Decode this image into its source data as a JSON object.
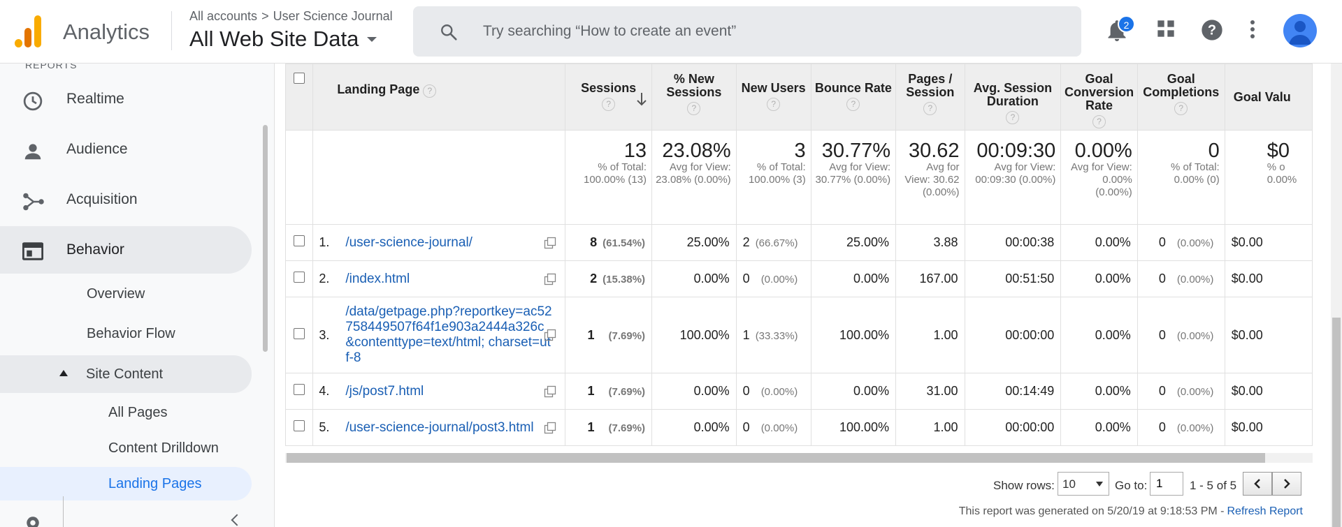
{
  "header": {
    "app_name": "Analytics",
    "breadcrumb_root": "All accounts",
    "breadcrumb_sep": ">",
    "breadcrumb_property": "User Science Journal",
    "view_name": "All Web Site Data",
    "search_placeholder": "Try searching “How to create an event”",
    "notification_count": "2",
    "icons": [
      "search-icon",
      "bell-icon",
      "apps-icon",
      "help-icon",
      "more-vert-icon",
      "avatar"
    ]
  },
  "sidebar": {
    "reports_label": "REPORTS",
    "items": [
      {
        "label": "Realtime",
        "icon": "clock-icon"
      },
      {
        "label": "Audience",
        "icon": "person-icon"
      },
      {
        "label": "Acquisition",
        "icon": "acquisition-icon"
      },
      {
        "label": "Behavior",
        "icon": "behavior-icon"
      }
    ],
    "behavior_sub": [
      "Overview",
      "Behavior Flow"
    ],
    "site_content": "Site Content",
    "site_content_sub": [
      "All Pages",
      "Content Drilldown",
      "Landing Pages"
    ]
  },
  "table": {
    "columns": {
      "landing_page": "Landing Page",
      "sessions": "Sessions",
      "new_sessions_pct": "% New Sessions",
      "new_users": "New Users",
      "bounce_rate": "Bounce Rate",
      "pages_session": "Pages / Session",
      "avg_duration": "Avg. Session Duration",
      "goal_conv": "Goal Conversion Rate",
      "goal_comp": "Goal Completions",
      "goal_value": "Goal Valu"
    },
    "totals": {
      "sessions": "13",
      "sessions_sub": "% of Total: 100.00% (13)",
      "new_sessions_pct": "23.08%",
      "new_sessions_pct_sub": "Avg for View: 23.08% (0.00%)",
      "new_users": "3",
      "new_users_sub": "% of Total: 100.00% (3)",
      "bounce_rate": "30.77%",
      "bounce_rate_sub": "Avg for View: 30.77% (0.00%)",
      "pages_session": "30.62",
      "pages_session_sub": "Avg for View: 30.62 (0.00%)",
      "avg_duration": "00:09:30",
      "avg_duration_sub": "Avg for View: 00:09:30 (0.00%)",
      "goal_conv": "0.00%",
      "goal_conv_sub": "Avg for View: 0.00% (0.00%)",
      "goal_comp": "0",
      "goal_comp_sub": "% of Total: 0.00% (0)",
      "goal_value": "$0",
      "goal_value_sub": "% o 0.00%"
    },
    "rows": [
      {
        "idx": "1.",
        "page": "/user-science-journal/",
        "sessions": "8",
        "sessions_pct": "(61.54%)",
        "new_sessions_pct": "25.00%",
        "new_users": "2",
        "new_users_pct": "(66.67%)",
        "bounce_rate": "25.00%",
        "pages_session": "3.88",
        "avg_duration": "00:00:38",
        "goal_conv": "0.00%",
        "goal_comp": "0",
        "goal_comp_pct": "(0.00%)",
        "goal_value": "$0.00"
      },
      {
        "idx": "2.",
        "page": "/index.html",
        "sessions": "2",
        "sessions_pct": "(15.38%)",
        "new_sessions_pct": "0.00%",
        "new_users": "0",
        "new_users_pct": "(0.00%)",
        "bounce_rate": "0.00%",
        "pages_session": "167.00",
        "avg_duration": "00:51:50",
        "goal_conv": "0.00%",
        "goal_comp": "0",
        "goal_comp_pct": "(0.00%)",
        "goal_value": "$0.00"
      },
      {
        "idx": "3.",
        "page": "/data/getpage.php?reportkey=ac52758449507f64f1e903a2444a326c&contenttype=text/html; charset=utf-8",
        "sessions": "1",
        "sessions_pct": "(7.69%)",
        "new_sessions_pct": "100.00%",
        "new_users": "1",
        "new_users_pct": "(33.33%)",
        "bounce_rate": "100.00%",
        "pages_session": "1.00",
        "avg_duration": "00:00:00",
        "goal_conv": "0.00%",
        "goal_comp": "0",
        "goal_comp_pct": "(0.00%)",
        "goal_value": "$0.00"
      },
      {
        "idx": "4.",
        "page": "/js/post7.html",
        "sessions": "1",
        "sessions_pct": "(7.69%)",
        "new_sessions_pct": "0.00%",
        "new_users": "0",
        "new_users_pct": "(0.00%)",
        "bounce_rate": "0.00%",
        "pages_session": "31.00",
        "avg_duration": "00:14:49",
        "goal_conv": "0.00%",
        "goal_comp": "0",
        "goal_comp_pct": "(0.00%)",
        "goal_value": "$0.00"
      },
      {
        "idx": "5.",
        "page": "/user-science-journal/post3.html",
        "sessions": "1",
        "sessions_pct": "(7.69%)",
        "new_sessions_pct": "0.00%",
        "new_users": "0",
        "new_users_pct": "(0.00%)",
        "bounce_rate": "100.00%",
        "pages_session": "1.00",
        "avg_duration": "00:00:00",
        "goal_conv": "0.00%",
        "goal_comp": "0",
        "goal_comp_pct": "(0.00%)",
        "goal_value": "$0.00"
      }
    ]
  },
  "pager": {
    "show_rows_label": "Show rows:",
    "show_rows_value": "10",
    "goto_label": "Go to:",
    "goto_value": "1",
    "range": "1 - 5 of 5"
  },
  "footer": {
    "generated": "This report was generated on 5/20/19 at 9:18:53 PM -",
    "refresh": "Refresh Report"
  },
  "colors": {
    "accent": "#1a73e8",
    "link": "#1a5fb4",
    "logo_orange": "#e37400",
    "logo_yellow": "#f9ab00"
  }
}
